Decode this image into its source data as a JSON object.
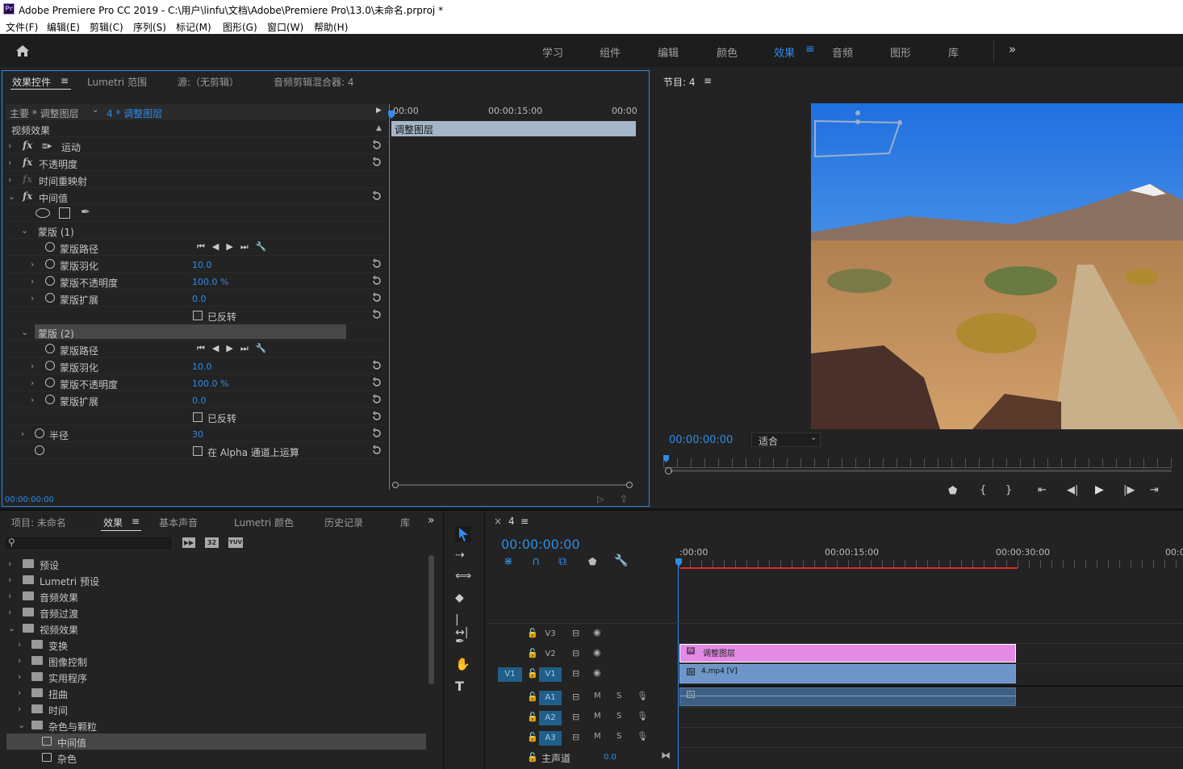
{
  "window": {
    "title": "Adobe Premiere Pro CC 2019 - C:\\用户\\linfu\\文档\\Adobe\\Premiere Pro\\13.0\\未命名.prproj *",
    "logo": "Pr"
  },
  "menu": [
    "文件(F)",
    "编辑(E)",
    "剪辑(C)",
    "序列(S)",
    "标记(M)",
    "图形(G)",
    "窗口(W)",
    "帮助(H)"
  ],
  "workspaces": {
    "items": [
      "学习",
      "组件",
      "编辑",
      "颜色",
      "效果",
      "音频",
      "图形",
      "库"
    ],
    "active": "效果",
    "more": "»"
  },
  "effect_controls": {
    "tabs": [
      "效果控件",
      "Lumetri 范围",
      "源:（无剪辑）",
      "音频剪辑混合器: 4"
    ],
    "master_label": "主要 * 调整图层",
    "clip_label": "4 * 调整图层",
    "section": "视频效果",
    "ruler": [
      "00:00",
      "00:00:15:00",
      "00:00"
    ],
    "clip_bar": "调整图层",
    "rows": {
      "motion": "运动",
      "opacity": "不透明度",
      "time_remap": "时间重映射",
      "median": "中间值",
      "mask1": "蒙版 (1)",
      "mask2": "蒙版 (2)",
      "mask_path": "蒙版路径",
      "mask_feather": "蒙版羽化",
      "mask_opacity": "蒙版不透明度",
      "mask_expansion": "蒙版扩展",
      "inverted": "已反转",
      "feather_val": "10.0",
      "opacity_val": "100.0 %",
      "expansion_val": "0.0",
      "radius": "半径",
      "radius_val": "30",
      "alpha": "在 Alpha 通道上运算"
    },
    "timecode": "00:00:00:00"
  },
  "program": {
    "title": "节目: 4",
    "timecode": "00:00:00:00",
    "fit": "适合"
  },
  "project": {
    "tabs": [
      "项目: 未命名",
      "效果",
      "基本声音",
      "Lumetri 颜色",
      "历史记录",
      "库"
    ],
    "search_placeholder": "",
    "tree": [
      "预设",
      "Lumetri 预设",
      "音频效果",
      "音频过渡",
      "视频效果",
      "变换",
      "图像控制",
      "实用程序",
      "扭曲",
      "时间",
      "杂色与颗粒",
      "中间值",
      "杂色"
    ],
    "badges": [
      "32",
      "YUV"
    ]
  },
  "timeline": {
    "tab": "4",
    "timecode": "00:00:00:00",
    "ruler": [
      ":00:00",
      "00:00:15:00",
      "00:00:30:00",
      "00:0"
    ],
    "tracks": {
      "v3": "V3",
      "v2": "V2",
      "v1": "V1",
      "src_v1": "V1",
      "a1": "A1",
      "a2": "A2",
      "a3": "A3",
      "m": "M",
      "s": "S"
    },
    "master": "主声道",
    "master_val": "0.0",
    "clips": {
      "adj": "调整图层",
      "video": "4.mp4 [V]"
    }
  },
  "colors": {
    "accent": "#2d8ceb",
    "adj_clip": "#e48ae4",
    "video_clip": "#6d95c7"
  }
}
